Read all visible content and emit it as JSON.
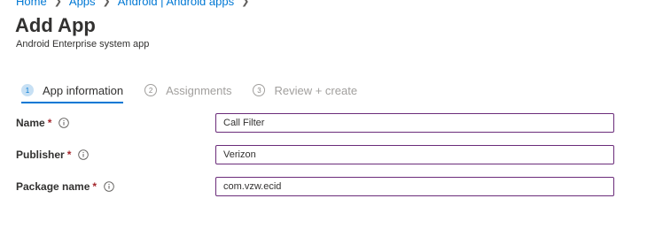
{
  "breadcrumb": {
    "items": [
      "Home",
      "Apps",
      "Android | Android apps"
    ]
  },
  "page": {
    "title": "Add App",
    "subtitle": "Android Enterprise system app"
  },
  "wizard": {
    "steps": [
      {
        "number": "1",
        "label": "App information",
        "state": "active"
      },
      {
        "number": "2",
        "label": "Assignments",
        "state": "inactive"
      },
      {
        "number": "3",
        "label": "Review + create",
        "state": "inactive"
      }
    ]
  },
  "form": {
    "required_marker": "*",
    "fields": [
      {
        "label": "Name",
        "value": "Call Filter"
      },
      {
        "label": "Publisher",
        "value": "Verizon"
      },
      {
        "label": "Package name",
        "value": "com.vzw.ecid"
      }
    ]
  },
  "colors": {
    "accent": "#0078d4",
    "required": "#a4262c",
    "input_border": "#6b2c7a"
  },
  "icons": {
    "field_info": "info-icon",
    "breadcrumb_separator": "chevron-right-icon"
  }
}
